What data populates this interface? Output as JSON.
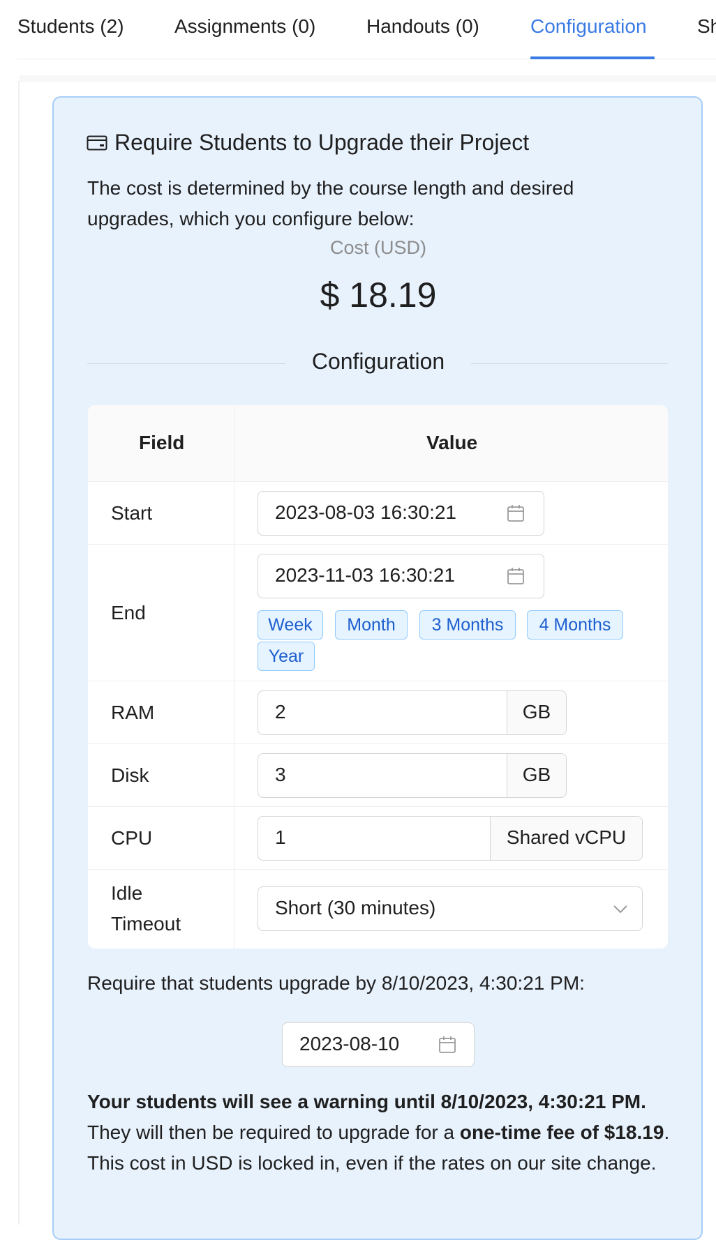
{
  "tabs": [
    {
      "label": "Students (2)"
    },
    {
      "label": "Assignments (0)"
    },
    {
      "label": "Handouts (0)"
    },
    {
      "label": "Configuration"
    },
    {
      "label": "Sh"
    }
  ],
  "card": {
    "title": "Require Students to Upgrade their Project",
    "icon": "credit-card-icon",
    "intro": "The cost is determined by the course length and desired upgrades, which you configure below:",
    "cost_label": "Cost (USD)",
    "cost_value": "$ 18.19",
    "section_title": "Configuration"
  },
  "table": {
    "headers": {
      "field": "Field",
      "value": "Value"
    },
    "start": {
      "label": "Start",
      "value": "2023-08-03 16:30:21"
    },
    "end": {
      "label": "End",
      "value": "2023-11-03 16:30:21",
      "presets": [
        "Week",
        "Month",
        "3 Months",
        "4 Months",
        "Year"
      ]
    },
    "ram": {
      "label": "RAM",
      "value": "2",
      "unit": "GB"
    },
    "disk": {
      "label": "Disk",
      "value": "3",
      "unit": "GB"
    },
    "cpu": {
      "label": "CPU",
      "value": "1",
      "unit": "Shared vCPU"
    },
    "idle": {
      "label_line1": "Idle",
      "label_line2": "Timeout",
      "value": "Short (30 minutes)"
    }
  },
  "require": {
    "text": "Require that students upgrade by 8/10/2023, 4:30:21 PM:",
    "date": "2023-08-10"
  },
  "warning": {
    "bold1": "Your students will see a warning until 8/10/2023, 4:30:21 PM.",
    "text1": " They will then be required to upgrade for a ",
    "bold2": "one-time fee of $18.19",
    "text2": ". This cost in USD is locked in, even if the rates on our site change."
  },
  "colors": {
    "accent": "#3a7be4",
    "card_bg": "#e8f2fd",
    "card_border": "#a6cdf5",
    "tag_text": "#1e5fcf"
  }
}
